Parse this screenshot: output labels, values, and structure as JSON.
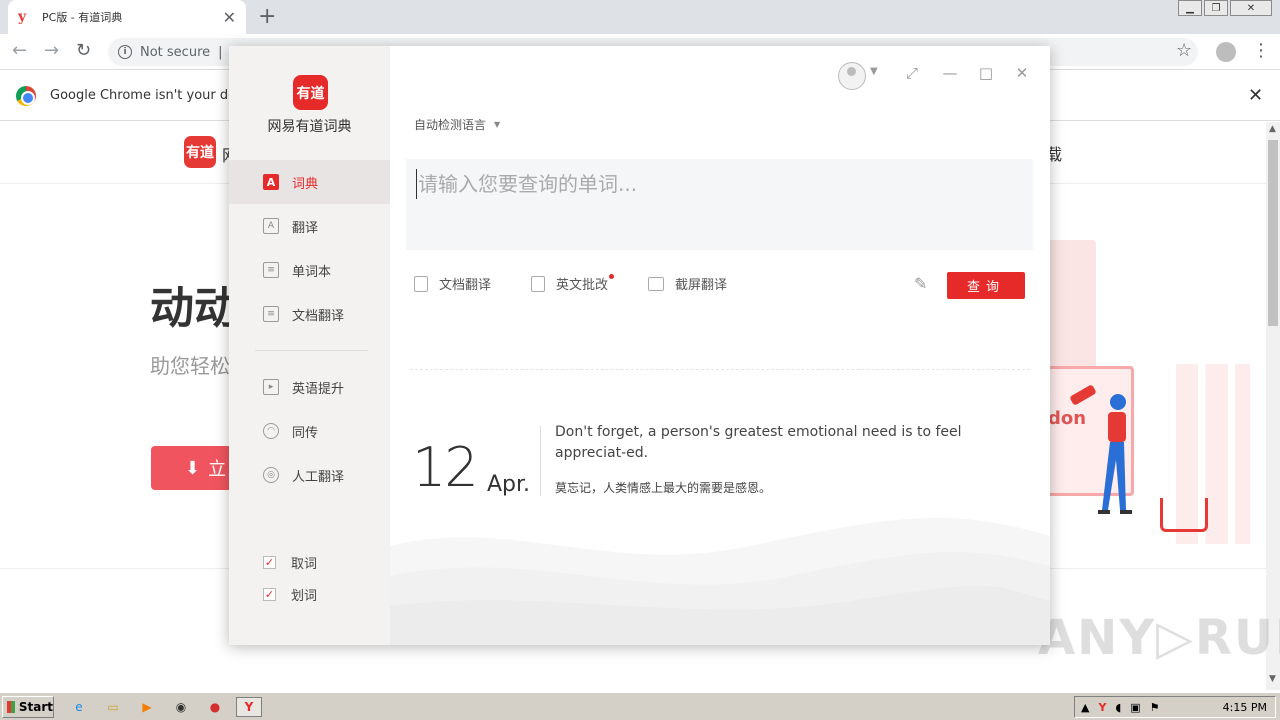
{
  "browser": {
    "tab_title": "PC版 - 有道词典",
    "tab_favicon": "y",
    "address_security": "Not secure",
    "address_sep": "|",
    "infobar_text": "Google Chrome isn't your default"
  },
  "webpage": {
    "logo_text": "有道",
    "site_name_partial": "网",
    "nav_tail": "载",
    "hero_title_partial": "动动",
    "hero_sub_partial": "助您轻松",
    "hero_button_partial": "立",
    "illustration_text": "don"
  },
  "app": {
    "logo_text": "有道",
    "name": "网易有道词典",
    "nav_items": [
      {
        "label": "词典",
        "icon": "A"
      },
      {
        "label": "翻译",
        "icon": "A"
      },
      {
        "label": "单词本",
        "icon": "≡"
      },
      {
        "label": "文档翻译",
        "icon": "≡"
      }
    ],
    "nav_items_2": [
      {
        "label": "英语提升",
        "icon": "▸"
      },
      {
        "label": "同传",
        "icon": "◠"
      },
      {
        "label": "人工翻译",
        "icon": "◎"
      }
    ],
    "checks": [
      {
        "label": "取词",
        "checked": "✓"
      },
      {
        "label": "划词",
        "checked": "✓"
      }
    ],
    "lang_select": "自动检测语言",
    "search_placeholder": "请输入您要查询的单词...",
    "tools": [
      {
        "label": "文档翻译",
        "has_dot": false
      },
      {
        "label": "英文批改",
        "has_dot": true
      },
      {
        "label": "截屏翻译",
        "has_dot": false
      }
    ],
    "query_button": "查询",
    "daily": {
      "day": "12",
      "month": "Apr.",
      "quote_en": "Don't forget, a person's greatest emotional need is to feel appreciat-ed.",
      "quote_zh": "莫忘记，人类情感上最大的需要是感恩。"
    }
  },
  "taskbar": {
    "start_label": "Start",
    "clock": "4:15 PM"
  },
  "watermark": "ANY▷RUN",
  "colors": {
    "accent": "#e62a2a",
    "sidebar_bg": "#f3f2f1",
    "search_bg": "#f4f6f8"
  }
}
